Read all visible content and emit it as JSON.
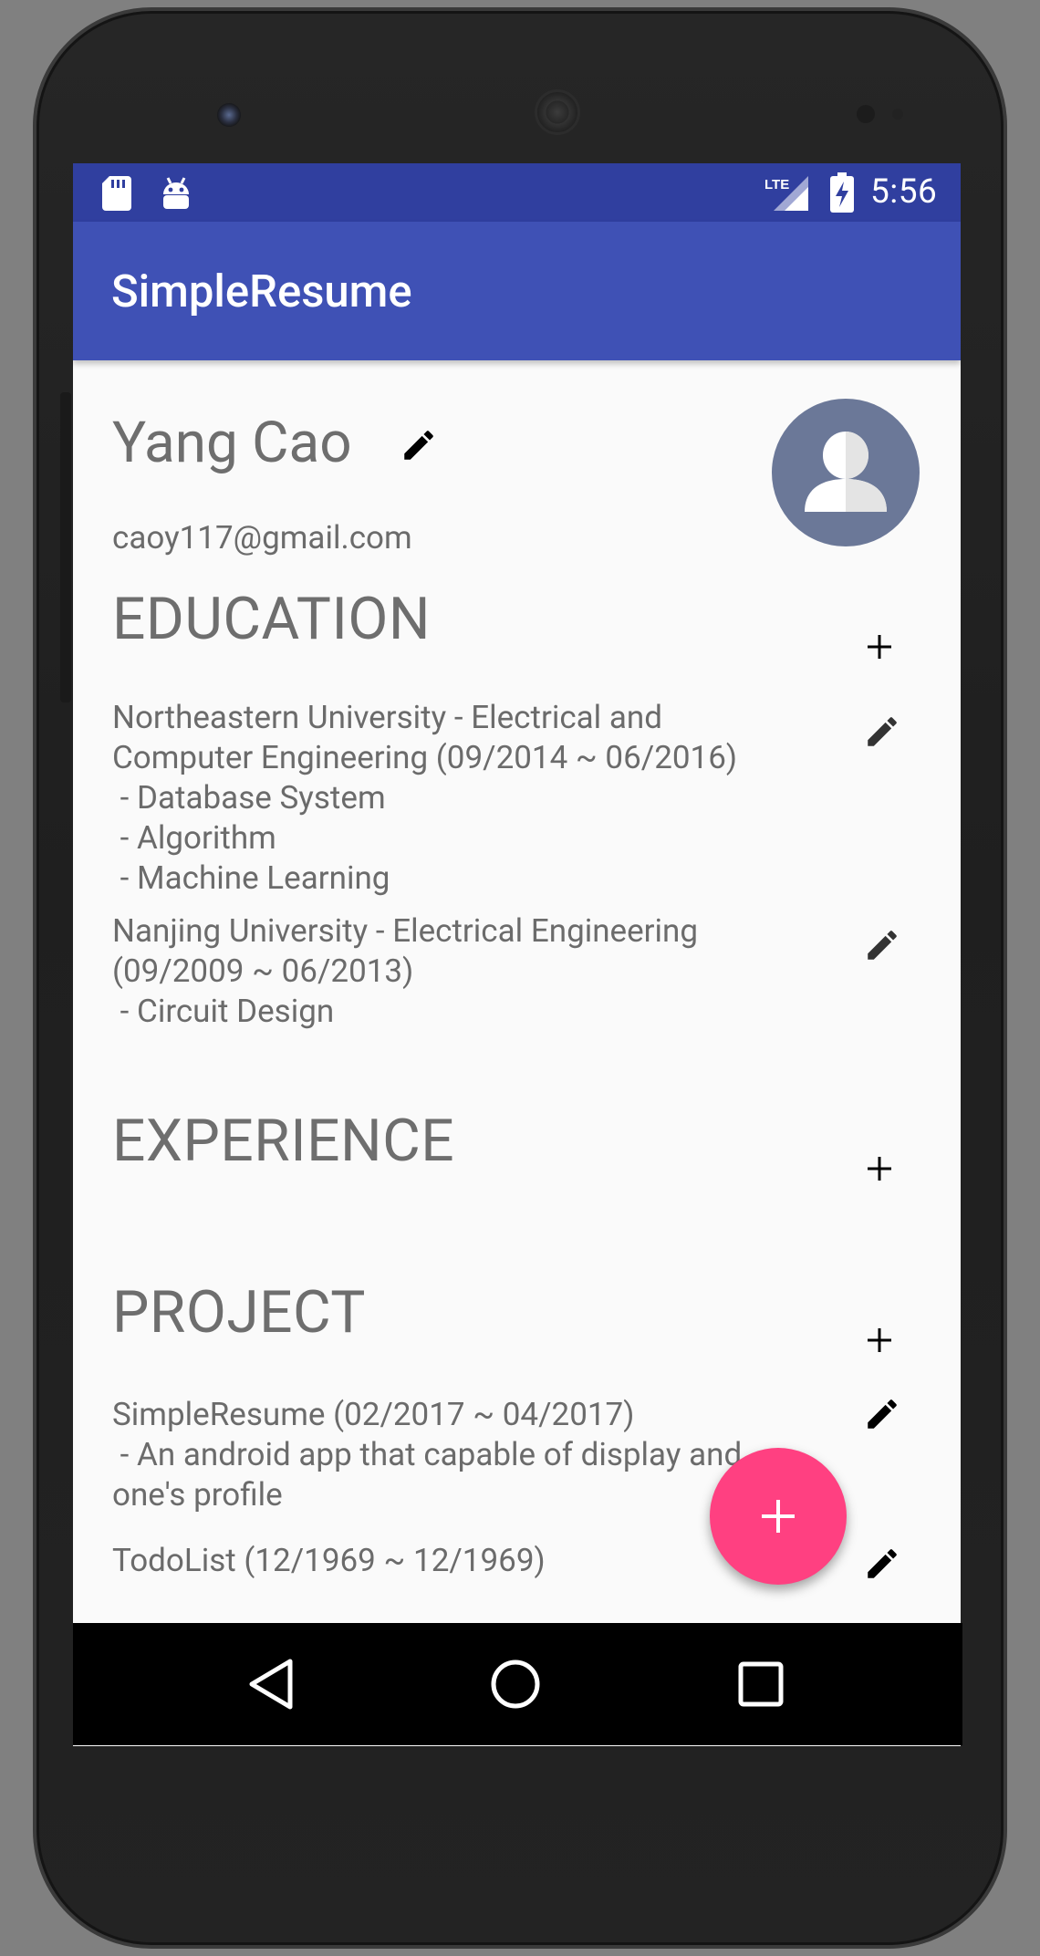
{
  "status_bar": {
    "time": "5:56",
    "network": "LTE"
  },
  "app_bar": {
    "title": "SimpleResume"
  },
  "profile": {
    "name": "Yang Cao",
    "email": "caoy117@gmail.com"
  },
  "education": {
    "title": "EDUCATION",
    "entries": [
      {
        "text": "Northeastern University - Electrical and\nComputer Engineering (09/2014 ~ 06/2016)\n - Database System\n - Algorithm\n - Machine Learning"
      },
      {
        "text": "Nanjing University - Electrical Engineering\n(09/2009 ~ 06/2013)\n - Circuit Design"
      }
    ]
  },
  "experience": {
    "title": "EXPERIENCE"
  },
  "project": {
    "title": "PROJECT",
    "entries": [
      {
        "text": "SimpleResume (02/2017 ~ 04/2017)\n - An android app that capable of display and\none's profile"
      },
      {
        "text": "TodoList (12/1969 ~ 12/1969)"
      }
    ]
  },
  "colors": {
    "primary": "#3f51b5",
    "primary_dark": "#303f9f",
    "accent": "#ff4081",
    "avatar_bg": "#6b7898",
    "text_secondary": "#6e6e6e"
  },
  "icons": {
    "edit": "pencil-icon",
    "add": "plus-icon",
    "fab": "plus-icon",
    "avatar": "person-icon"
  }
}
